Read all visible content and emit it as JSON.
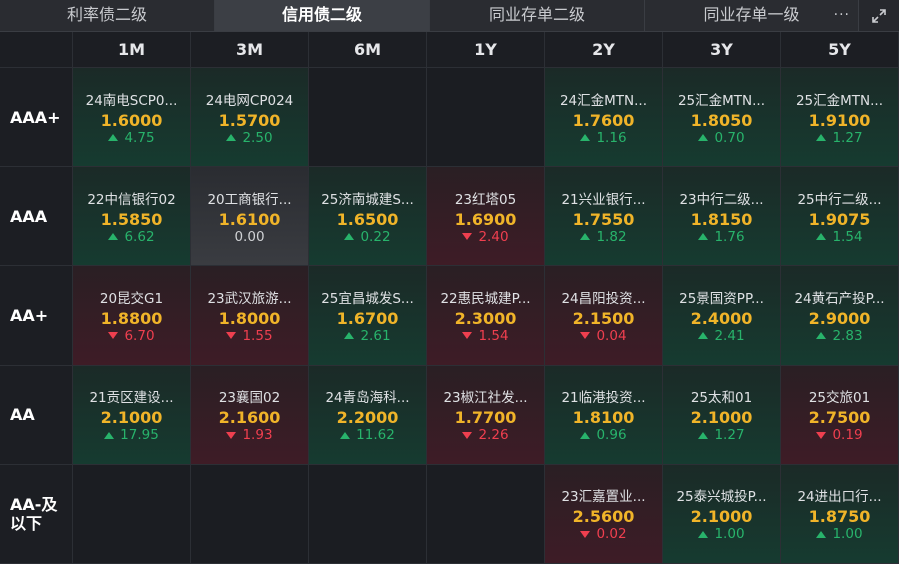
{
  "tabs": [
    {
      "label": "利率债二级",
      "active": false
    },
    {
      "label": "信用债二级",
      "active": true
    },
    {
      "label": "同业存单二级",
      "active": false
    },
    {
      "label": "同业存单一级",
      "active": false
    }
  ],
  "more_icon": "···",
  "terms": [
    "1M",
    "3M",
    "6M",
    "1Y",
    "2Y",
    "3Y",
    "5Y"
  ],
  "rows": [
    {
      "rating": "AAA+",
      "cells": [
        {
          "name": "24南电SCP0...",
          "value": "1.6000",
          "change": "4.75",
          "dir": "up"
        },
        {
          "name": "24电网CP024",
          "value": "1.5700",
          "change": "2.50",
          "dir": "up"
        },
        null,
        null,
        {
          "name": "24汇金MTN...",
          "value": "1.7600",
          "change": "1.16",
          "dir": "up"
        },
        {
          "name": "25汇金MTN...",
          "value": "1.8050",
          "change": "0.70",
          "dir": "up"
        },
        {
          "name": "25汇金MTN...",
          "value": "1.9100",
          "change": "1.27",
          "dir": "up"
        }
      ]
    },
    {
      "rating": "AAA",
      "cells": [
        {
          "name": "22中信银行02",
          "value": "1.5850",
          "change": "6.62",
          "dir": "up"
        },
        {
          "name": "20工商银行...",
          "value": "1.6100",
          "change": "0.00",
          "dir": "flat"
        },
        {
          "name": "25济南城建S...",
          "value": "1.6500",
          "change": "0.22",
          "dir": "up"
        },
        {
          "name": "23红塔05",
          "value": "1.6900",
          "change": "2.40",
          "dir": "down"
        },
        {
          "name": "21兴业银行...",
          "value": "1.7550",
          "change": "1.82",
          "dir": "up"
        },
        {
          "name": "23中行二级...",
          "value": "1.8150",
          "change": "1.76",
          "dir": "up"
        },
        {
          "name": "25中行二级...",
          "value": "1.9075",
          "change": "1.54",
          "dir": "up"
        }
      ]
    },
    {
      "rating": "AA+",
      "cells": [
        {
          "name": "20昆交G1",
          "value": "1.8800",
          "change": "6.70",
          "dir": "down"
        },
        {
          "name": "23武汉旅游...",
          "value": "1.8000",
          "change": "1.55",
          "dir": "down"
        },
        {
          "name": "25宜昌城发S...",
          "value": "1.6700",
          "change": "2.61",
          "dir": "up"
        },
        {
          "name": "22惠民城建P...",
          "value": "2.3000",
          "change": "1.54",
          "dir": "down"
        },
        {
          "name": "24昌阳投资...",
          "value": "2.1500",
          "change": "0.04",
          "dir": "down"
        },
        {
          "name": "25景国资PP...",
          "value": "2.4000",
          "change": "2.41",
          "dir": "up"
        },
        {
          "name": "24黄石产投P...",
          "value": "2.9000",
          "change": "2.83",
          "dir": "up"
        }
      ]
    },
    {
      "rating": "AA",
      "cells": [
        {
          "name": "21贡区建设...",
          "value": "2.1000",
          "change": "17.95",
          "dir": "up"
        },
        {
          "name": "23襄国02",
          "value": "2.1600",
          "change": "1.93",
          "dir": "down"
        },
        {
          "name": "24青岛海科...",
          "value": "2.2000",
          "change": "11.62",
          "dir": "up"
        },
        {
          "name": "23椒江社发...",
          "value": "1.7700",
          "change": "2.26",
          "dir": "down"
        },
        {
          "name": "21临港投资...",
          "value": "1.8100",
          "change": "0.96",
          "dir": "up"
        },
        {
          "name": "25太和01",
          "value": "2.1000",
          "change": "1.27",
          "dir": "up"
        },
        {
          "name": "25交旅01",
          "value": "2.7500",
          "change": "0.19",
          "dir": "down"
        }
      ]
    },
    {
      "rating": "AA-及以下",
      "cells": [
        null,
        null,
        null,
        null,
        {
          "name": "23汇嘉置业...",
          "value": "2.5600",
          "change": "0.02",
          "dir": "down"
        },
        {
          "name": "25泰兴城投P...",
          "value": "2.1000",
          "change": "1.00",
          "dir": "up"
        },
        {
          "name": "24进出口行...",
          "value": "1.8750",
          "change": "1.00",
          "dir": "up"
        }
      ]
    }
  ]
}
